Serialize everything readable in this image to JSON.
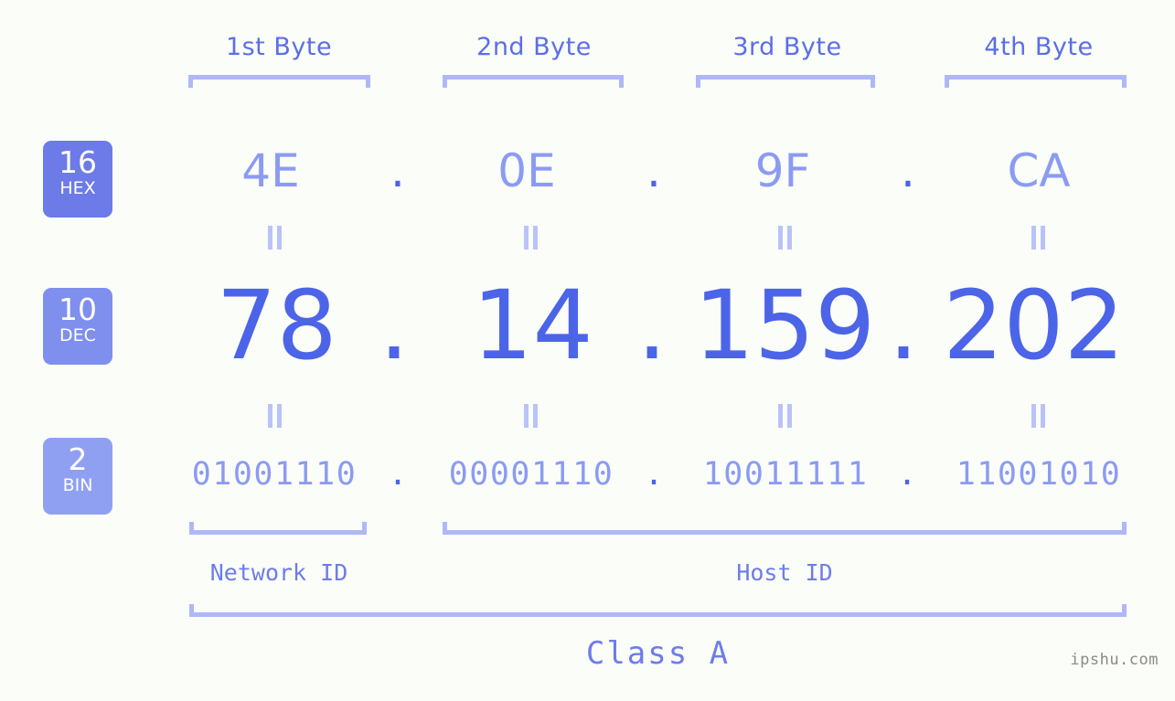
{
  "diagram": {
    "byte_headers": [
      "1st Byte",
      "2nd Byte",
      "3rd Byte",
      "4th Byte"
    ],
    "separator": ".",
    "rows": [
      {
        "base": "16",
        "base_name": "HEX",
        "badge_color": "#6c7be8",
        "values": [
          "4E",
          "0E",
          "9F",
          "CA"
        ]
      },
      {
        "base": "10",
        "base_name": "DEC",
        "badge_color": "#7e8fee",
        "values": [
          "78",
          "14",
          "159",
          "202"
        ]
      },
      {
        "base": "2",
        "base_name": "BIN",
        "badge_color": "#8fa0f2",
        "values": [
          "01001110",
          "00001110",
          "10011111",
          "11001010"
        ]
      }
    ],
    "network_id_label": "Network ID",
    "host_id_label": "Host ID",
    "class_label": "Class A",
    "watermark": "ipshu.com",
    "colors": {
      "background": "#fbfdf9",
      "accent_strong": "#4c64e8",
      "accent_light": "#8b9bf2",
      "bracket": "#aeb8f7",
      "header_text": "#5b6ee8",
      "caption": "#6d7ce9",
      "watermark": "#8a8a8a"
    }
  }
}
